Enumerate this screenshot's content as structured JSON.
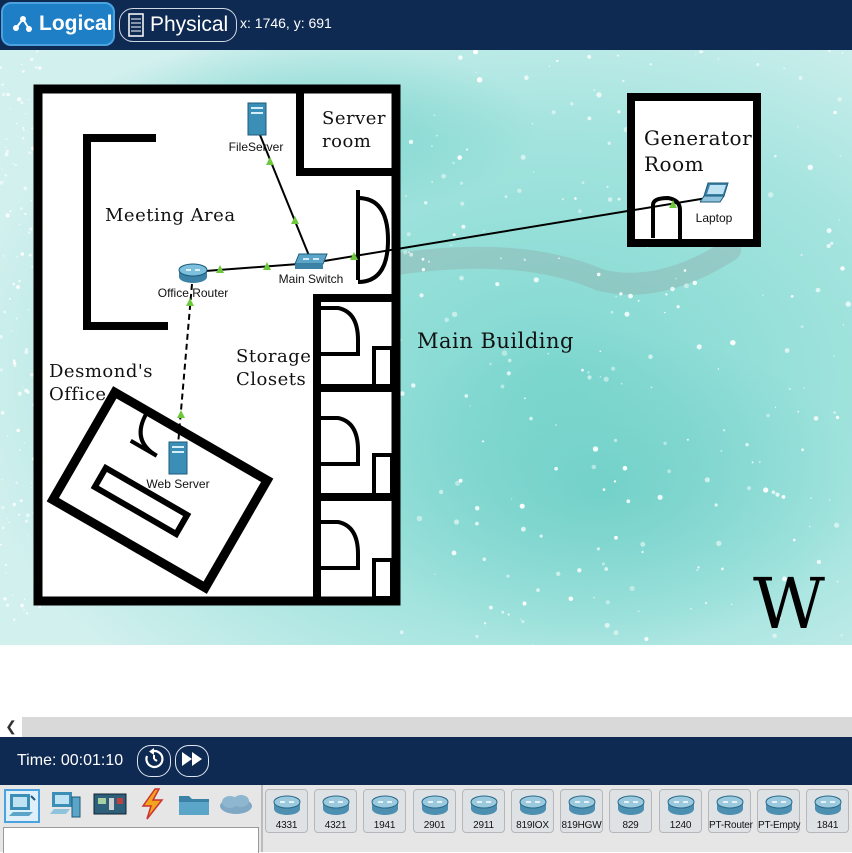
{
  "header": {
    "tabs": [
      {
        "label": "Logical",
        "icon": "logical-topology-icon",
        "active": true
      },
      {
        "label": "Physical",
        "icon": "physical-rack-icon",
        "active": false
      }
    ],
    "coordinates": "x: 1746, y: 691"
  },
  "workspace": {
    "colors": {
      "background_tint": "#8ad9d3",
      "walls": "#000000",
      "links": "#000000",
      "link_indicator": "#6ec83c"
    },
    "rooms": {
      "server_room": "Server\nroom",
      "meeting_area": "Meeting Area",
      "storage_closets": "Storage\nClosets",
      "desmonds_office": "Desmond's\nOffice",
      "generator_room": "Generator\nRoom",
      "main_building": "Main Building"
    },
    "watermark": "W",
    "devices": [
      {
        "key": "fileserver",
        "label": "FileServer",
        "icon": "server-icon"
      },
      {
        "key": "main_switch",
        "label": "Main Switch",
        "icon": "switch-icon"
      },
      {
        "key": "office_router",
        "label": "Office Router",
        "icon": "router-icon"
      },
      {
        "key": "web_server",
        "label": "Web Server",
        "icon": "server-icon"
      },
      {
        "key": "laptop",
        "label": "Laptop",
        "icon": "laptop-icon"
      }
    ]
  },
  "timebar": {
    "time": "Time: 00:01:10",
    "buttons": [
      "reset-icon",
      "fast-forward-icon"
    ]
  },
  "palette": {
    "categories": [
      "network-devices-icon",
      "end-devices-icon",
      "components-icon",
      "connections-icon",
      "miscellaneous-icon",
      "multiuser-icon"
    ],
    "models": [
      "4331",
      "4321",
      "1941",
      "2901",
      "2911",
      "819IOX",
      "819HGW",
      "829",
      "1240",
      "PT-Router",
      "PT-Empty",
      "1841"
    ]
  }
}
